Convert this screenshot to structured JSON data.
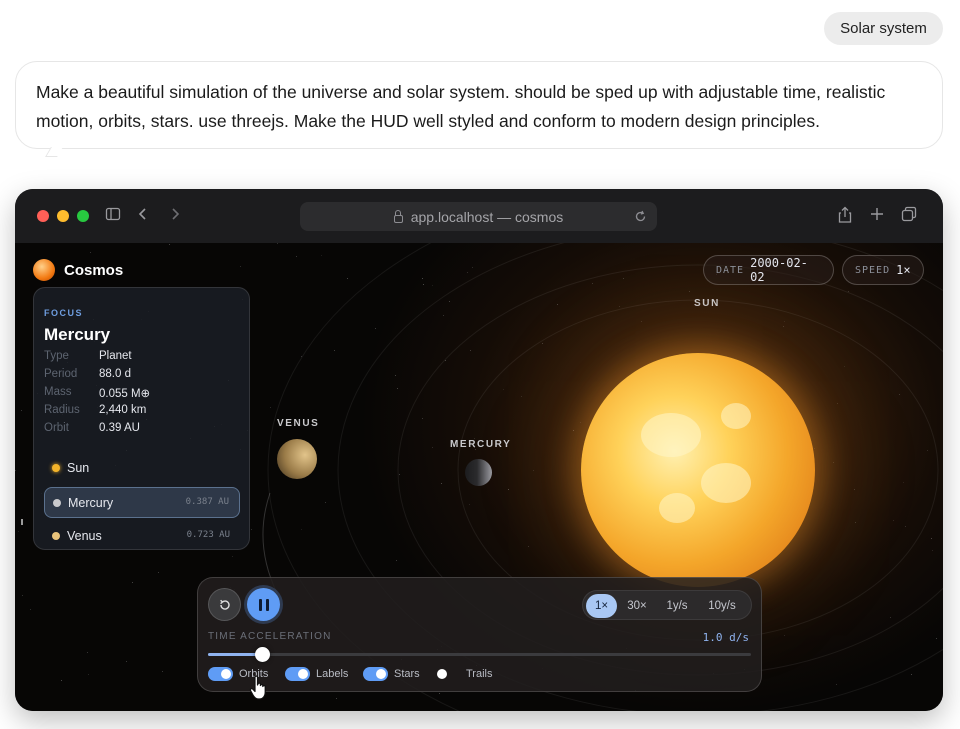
{
  "chat": {
    "chip_label": "Solar system",
    "prompt": "Make a beautiful simulation of the universe and solar system. should be sped up with adjustable time, realistic motion, orbits, stars. use threejs. Make the HUD well styled and conform to modern design principles."
  },
  "browser": {
    "url": "app.localhost — cosmos",
    "traffic_colors": [
      "#ff5f57",
      "#febc2e",
      "#28c840"
    ]
  },
  "app": {
    "brand": "Cosmos",
    "date_key": "DATE",
    "date_value": "2000-02-02",
    "speed_key": "SPEED",
    "speed_value": "1×"
  },
  "scene": {
    "sun_label": "SUN",
    "venus_label": "VENUS",
    "mercury_label": "MERCURY"
  },
  "focus": {
    "kicker": "FOCUS",
    "title": "Mercury",
    "rows": [
      {
        "key": "Type",
        "value": "Planet"
      },
      {
        "key": "Period",
        "value": "88.0 d"
      },
      {
        "key": "Mass",
        "value": "0.055 M⊕"
      },
      {
        "key": "Radius",
        "value": "2,440 km"
      },
      {
        "key": "Orbit",
        "value": "0.39 AU"
      }
    ],
    "bodies": [
      {
        "name": "Sun",
        "distance": "",
        "color": "#f4b42a"
      },
      {
        "name": "Mercury",
        "distance": "0.387 AU",
        "color": "#c9c9cc"
      },
      {
        "name": "Venus",
        "distance": "0.723 AU",
        "color": "#e8c27a"
      }
    ]
  },
  "controls": {
    "speed_options": [
      "1×",
      "30×",
      "1y/s",
      "10y/s"
    ],
    "active_speed": "1×",
    "time_acceleration_label": "TIME ACCELERATION",
    "time_acceleration_value": "1.0 d/s",
    "slider_level": 0.1,
    "toggles": [
      {
        "label": "Orbits",
        "on": true
      },
      {
        "label": "Labels",
        "on": true
      },
      {
        "label": "Stars",
        "on": true
      },
      {
        "label": "Trails",
        "on": false
      }
    ]
  }
}
